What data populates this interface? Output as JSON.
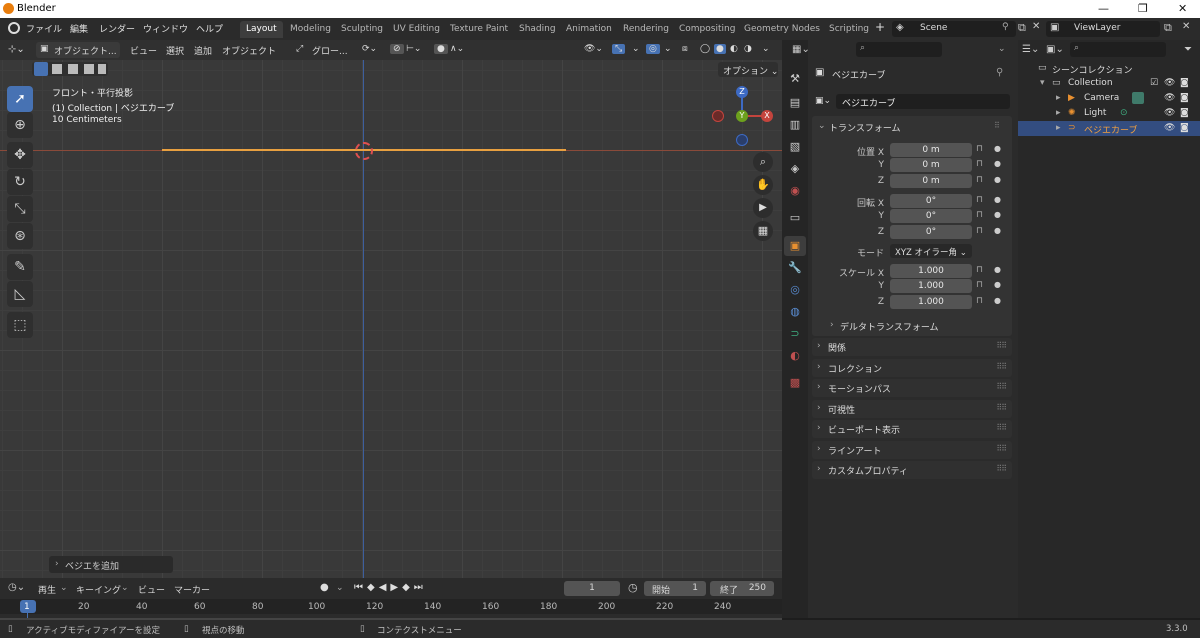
{
  "window": {
    "title": "Blender",
    "minimize": "—",
    "maximize": "❐",
    "close": "✕"
  },
  "menu": {
    "file": "ファイル",
    "edit": "編集",
    "render": "レンダー",
    "window": "ウィンドウ",
    "help": "ヘルプ"
  },
  "workspaces": [
    "Layout",
    "Modeling",
    "Sculpting",
    "UV Editing",
    "Texture Paint",
    "Shading",
    "Animation",
    "Rendering",
    "Compositing",
    "Geometry Nodes",
    "Scripting"
  ],
  "add_workspace": "+",
  "scene": {
    "name": "Scene",
    "view_layer": "ViewLayer"
  },
  "viewport_header": {
    "mode": "オブジェクト...",
    "view": "ビュー",
    "select": "選択",
    "add": "追加",
    "object": "オブジェクト",
    "transform_orientation": "グロー...",
    "options": "オプション"
  },
  "viewport_overlay": {
    "view_name": "フロント・平行投影",
    "collection_line": "(1) Collection | ベジエカーブ",
    "scale": "10 Centimeters",
    "gizmo_x": "X",
    "gizmo_y": "Y",
    "gizmo_z": "Z"
  },
  "last_operator": "ベジエを追加",
  "properties": {
    "object_name_header": "ベジエカーブ",
    "object_name_field": "ベジエカーブ",
    "transform_panel": "トランスフォーム",
    "location_label": "位置 X",
    "loc_x": "0 m",
    "loc_y": "0 m",
    "loc_z": "0 m",
    "rotation_label": "回転 X",
    "rot_x": "0°",
    "rot_y": "0°",
    "rot_z": "0°",
    "mode_label": "モード",
    "mode_value": "XYZ オイラー角",
    "scale_label": "スケール X",
    "scale_x": "1.000",
    "scale_y": "1.000",
    "scale_z": "1.000",
    "axis_y": "Y",
    "axis_z": "Z",
    "delta_transform": "デルタトランスフォーム",
    "panels": [
      "関係",
      "コレクション",
      "モーションパス",
      "可視性",
      "ビューポート表示",
      "ラインアート",
      "カスタムプロパティ"
    ]
  },
  "outliner": {
    "scene_collection": "シーンコレクション",
    "collection": "Collection",
    "items": [
      "Camera",
      "Light",
      "ベジエカーブ"
    ]
  },
  "timeline": {
    "playback": "再生",
    "keying": "キーイング",
    "view": "ビュー",
    "marker": "マーカー",
    "current_frame": "1",
    "start_label": "開始",
    "start": "1",
    "end_label": "終了",
    "end": "250",
    "ticks": [
      "1",
      "20",
      "40",
      "60",
      "80",
      "100",
      "120",
      "140",
      "160",
      "180",
      "200",
      "220",
      "240"
    ]
  },
  "status": {
    "left": "アクティブモディファイアーを設定",
    "middle": "視点の移動",
    "right": "コンテクストメニュー",
    "version": "3.3.0"
  },
  "colors": {
    "accent": "#4772b3",
    "selection": "#334d80",
    "curve": "#e8a040",
    "x_axis": "#c4443d",
    "y_axis": "#6da11d",
    "z_axis": "#3d6ac4"
  }
}
